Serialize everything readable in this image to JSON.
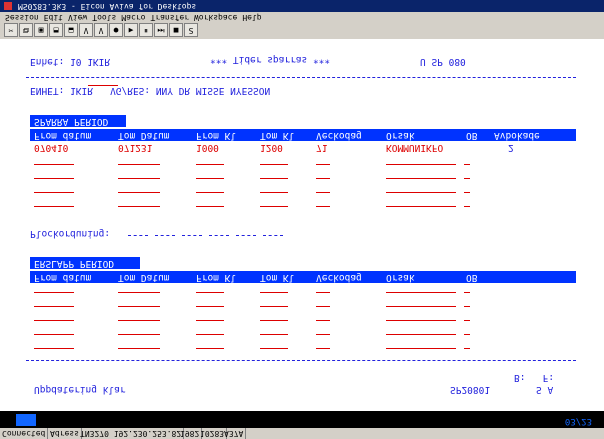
{
  "titlebar": {
    "title": "MS0283.3k3 - Eicon Aviva for Desktops"
  },
  "menu": [
    "Session",
    "Edit",
    "View",
    "Tools",
    "Macro",
    "Transfer",
    "Workspace",
    "Help"
  ],
  "toolbar": [
    "✂",
    "⧉",
    "▣",
    "⬒",
    "⬓",
    "V",
    "V",
    "●",
    "▶",
    "⏸",
    "⏭",
    "■",
    "Ƨ"
  ],
  "statusbar": [
    "Connected",
    "Adress",
    "TN3270 192.230.253.82",
    "1982",
    "10283",
    "A37A"
  ],
  "indicator": "03/23",
  "screen": {
    "title": "Uppdatering klar",
    "id": "SP20801",
    "mode": "S A",
    "page": "B:   F:",
    "separator_dashes": "",
    "period1_heading": "ERSLAPP PERIOD",
    "columns": [
      "From datum",
      "Tom Datum",
      "From Kl",
      "Tom Kl",
      "Veckodag",
      "Orsak",
      "OB",
      "Avbokade"
    ],
    "plocklabel": "Plockorduning:",
    "period2_heading": "SPARRA PERIOD",
    "row": {
      "from_date": "070410",
      "tom_date": "071231",
      "from_kl": "1000",
      "tom_kl": "1200",
      "veckodag": "71",
      "orsak": "KOMMUNIKFO",
      "ob": "",
      "avbokade": "2"
    },
    "enhet_line": "ENHET: 1KIR   VG/RES: NNY DR MISSE NYESSON",
    "footer_enhet": "Enhet: 10 1KIR",
    "footer_msg": "*** Tider sparras ***",
    "footer_code": "U SP 080"
  }
}
